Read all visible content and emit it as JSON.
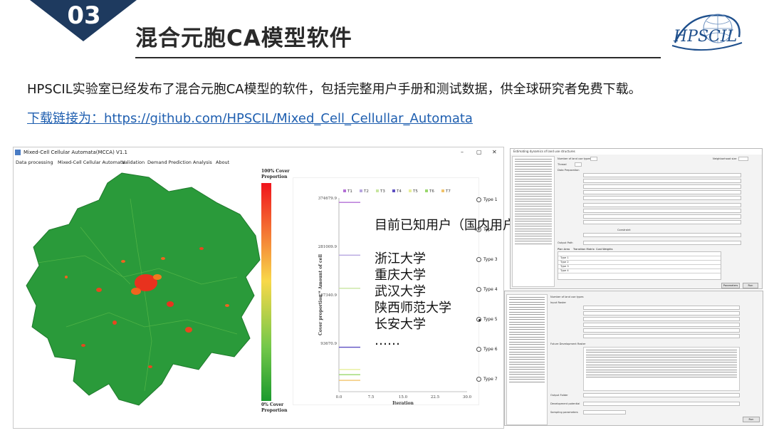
{
  "slide": {
    "number": "03",
    "title": "混合元胞CA模型软件",
    "intro": "HPSCIL实验室已经发布了混合元胞CA模型的软件，包括完整用户手册和测试数据，供全球研究者免费下载。",
    "download_link": "下载链接为：https://github.com/HPSCIL/Mixed_Cell_Cellullar_Automata",
    "logo_text": "HPSCIL",
    "users_heading": "目前已知用户（国内用户较多，只列举部分）",
    "users": [
      "浙江大学",
      "重庆大学",
      "武汉大学",
      "陕西师范大学",
      "长安大学",
      "……"
    ],
    "colors": {
      "banner": "#1e3a5f",
      "link": "#1f5fb0",
      "title": "#2a2a2a"
    }
  },
  "mcca": {
    "title": "Mixed-Cell Cellular Automata(MCCA) V1.1",
    "controls": [
      "–",
      "▢",
      "✕"
    ],
    "menu": [
      "Data processing",
      "Mixed-Cell Cellular Automata",
      "Validation",
      "Demand Prediction",
      "Analysis",
      "About"
    ],
    "legend_top": [
      "100% Cover",
      "Proportion"
    ],
    "legend_bottom": [
      "0% Cover",
      "Proportion"
    ],
    "types": [
      "Type 1",
      "Type 2",
      "Type 3",
      "Type 4",
      "Type 5",
      "Type 6",
      "Type 7"
    ],
    "selected_type": "Type 5"
  },
  "chart_data": {
    "type": "line",
    "legend": [
      "T1",
      "T2",
      "T3",
      "T4",
      "T5",
      "T6",
      "T7"
    ],
    "legend_colors": [
      "#b36fd6",
      "#b7a6e0",
      "#c8e6a0",
      "#5e4fc2",
      "#e7ef9a",
      "#9ad86d",
      "#f2c46b"
    ],
    "xlabel": "Iteration",
    "ylabel": "Cover proportion * Amount of cell",
    "xticks": [
      "0.0",
      "7.5",
      "15.0",
      "22.5",
      "30.0"
    ],
    "yticks": [
      "93670.9",
      "187340.9",
      "281009.9",
      "374679.9"
    ],
    "xlim": [
      0,
      30
    ],
    "ylim": [
      0,
      374679.9
    ],
    "series": [
      {
        "values": [
          [
            0,
            366200
          ],
          [
            1,
            366200
          ],
          [
            2,
            366200
          ],
          [
            3,
            366200
          ],
          [
            4,
            366200
          ],
          [
            5,
            366200
          ]
        ]
      },
      {
        "values": [
          [
            0,
            264000
          ],
          [
            1,
            264000
          ],
          [
            2,
            264000
          ],
          [
            3,
            264000
          ],
          [
            4,
            264000
          ],
          [
            5,
            264000
          ]
        ]
      },
      {
        "values": [
          [
            0,
            200000
          ],
          [
            1,
            200000
          ],
          [
            2,
            200000
          ],
          [
            3,
            200000
          ],
          [
            4,
            200000
          ],
          [
            5,
            200000
          ]
        ]
      },
      {
        "values": [
          [
            0,
            86000
          ],
          [
            1,
            86000
          ],
          [
            2,
            86000
          ],
          [
            3,
            86000
          ],
          [
            4,
            86000
          ],
          [
            5,
            86000
          ]
        ]
      },
      {
        "values": [
          [
            0,
            43000
          ],
          [
            1,
            43000
          ],
          [
            2,
            43000
          ],
          [
            3,
            43000
          ],
          [
            4,
            43000
          ],
          [
            5,
            43000
          ]
        ]
      },
      {
        "values": [
          [
            0,
            33000
          ],
          [
            1,
            33000
          ],
          [
            2,
            33000
          ],
          [
            3,
            33000
          ],
          [
            4,
            33000
          ],
          [
            5,
            33000
          ]
        ]
      },
      {
        "values": [
          [
            0,
            22000
          ],
          [
            1,
            22000
          ],
          [
            2,
            22000
          ],
          [
            3,
            22000
          ],
          [
            4,
            22000
          ],
          [
            5,
            22000
          ]
        ]
      }
    ]
  },
  "panel_top": {
    "title": "Estimating dynamics of land use structures",
    "labels": [
      "Number of land use types",
      "Thread",
      "Data Preparation",
      "Neighborhood size",
      "Constraint",
      "Output Path"
    ],
    "tabs": [
      "Plan Area",
      "Transition Matrix",
      "Cost Weights"
    ],
    "row_labels": [
      "Type 1",
      "Type 2",
      "Type 3",
      "Type 4"
    ],
    "buttons": [
      "Parameters",
      "Run"
    ]
  },
  "panel_bottom": {
    "labels": [
      "Number of land use types",
      "Input Raster",
      "Future Development Raster",
      "Output Folder",
      "Development potential",
      "Sampling parameters"
    ],
    "buttons": [
      "Run"
    ]
  }
}
